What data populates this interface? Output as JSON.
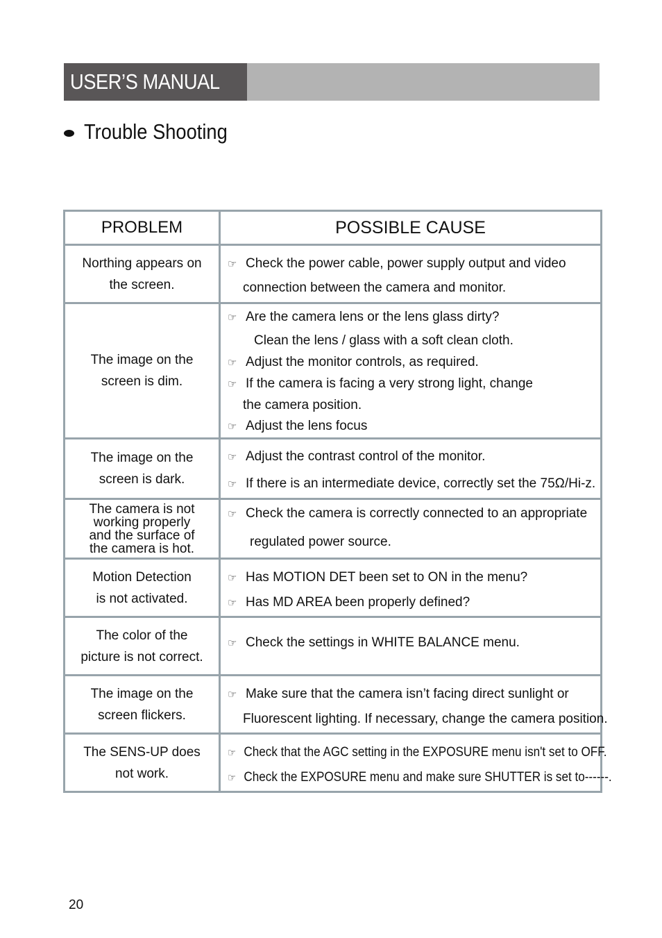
{
  "header": {
    "title": "USER’S MANUAL",
    "colors": {
      "title_bg": "#595657",
      "bar_bg": "#b3b3b3",
      "table_border": "#98a4ab"
    }
  },
  "section": {
    "title": "Trouble Shooting",
    "bullet_icon": "bullet-dot"
  },
  "table": {
    "headers": {
      "problem": "PROBLEM",
      "cause": "POSSIBLE  CAUSE"
    },
    "pointer_icon": "☞",
    "rows": [
      {
        "problem": [
          "Northing appears on",
          "the screen."
        ],
        "causes": [
          {
            "icon": true,
            "text": "Check the power cable, power supply output and video"
          },
          {
            "icon": false,
            "text": "connection between the camera and monitor."
          }
        ]
      },
      {
        "problem": [
          "The image on the",
          "screen is dim."
        ],
        "causes": [
          {
            "icon": true,
            "text": "Are the camera lens or the lens glass dirty?"
          },
          {
            "icon": false,
            "text": "Clean the lens / glass with a soft clean cloth."
          },
          {
            "icon": true,
            "text": "Adjust the monitor controls, as required."
          },
          {
            "icon": true,
            "text": "If the camera is facing a very strong light, change"
          },
          {
            "icon": false,
            "text": "the camera position."
          },
          {
            "icon": true,
            "text": "Adjust the lens focus"
          }
        ]
      },
      {
        "problem": [
          "The image on the",
          "screen is dark."
        ],
        "causes": [
          {
            "icon": true,
            "text": "Adjust the contrast control of the monitor."
          },
          {
            "icon": true,
            "text": "If there is an intermediate device, correctly set the 75Ω/Hi-z."
          }
        ]
      },
      {
        "problem": [
          "The camera is not",
          "working properly",
          "and the surface of",
          "the camera is hot."
        ],
        "causes": [
          {
            "icon": true,
            "text": "Check the camera is correctly connected to an appropriate"
          },
          {
            "icon": false,
            "text": "regulated power source."
          }
        ]
      },
      {
        "problem": [
          "Motion Detection",
          "is not activated."
        ],
        "causes": [
          {
            "icon": true,
            "text": "Has MOTION DET been set to ON in the menu?"
          },
          {
            "icon": true,
            "text": "Has MD AREA been properly defined?"
          }
        ]
      },
      {
        "problem": [
          "The color of the",
          "picture is not correct."
        ],
        "causes": [
          {
            "icon": true,
            "text": "Check the settings in WHITE BALANCE menu."
          }
        ]
      },
      {
        "problem": [
          "The image on the",
          "screen flickers."
        ],
        "causes": [
          {
            "icon": true,
            "text": "Make sure that the camera isn’t facing direct sunlight or"
          },
          {
            "icon": false,
            "text": "Fluorescent lighting. If necessary, change the camera position."
          }
        ]
      },
      {
        "problem": [
          "The SENS-UP does",
          "not work."
        ],
        "causes": [
          {
            "icon": true,
            "text": "Check that the AGC setting in the EXPOSURE menu isn't set to OFF."
          },
          {
            "icon": true,
            "text": "Check the EXPOSURE menu and make sure SHUTTER is set to------."
          }
        ]
      }
    ]
  },
  "footer": {
    "page_number": "20"
  }
}
